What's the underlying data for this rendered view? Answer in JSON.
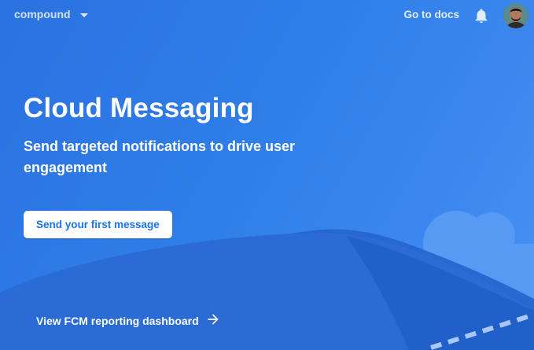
{
  "header": {
    "project_name": "compound",
    "docs_link": "Go to docs"
  },
  "hero": {
    "title": "Cloud Messaging",
    "subtitle": "Send targeted notifications to drive user engagement",
    "primary_button": "Send your first message",
    "secondary_link": "View FCM reporting dashboard"
  },
  "icons": {
    "project_dropdown": "caret-down-icon",
    "notifications": "bell-icon",
    "profile": "avatar",
    "dashboard_link": "arrow-right-icon"
  },
  "colors": {
    "background": "#2f7ee8",
    "button_text": "#1a73e8",
    "white": "#ffffff"
  }
}
